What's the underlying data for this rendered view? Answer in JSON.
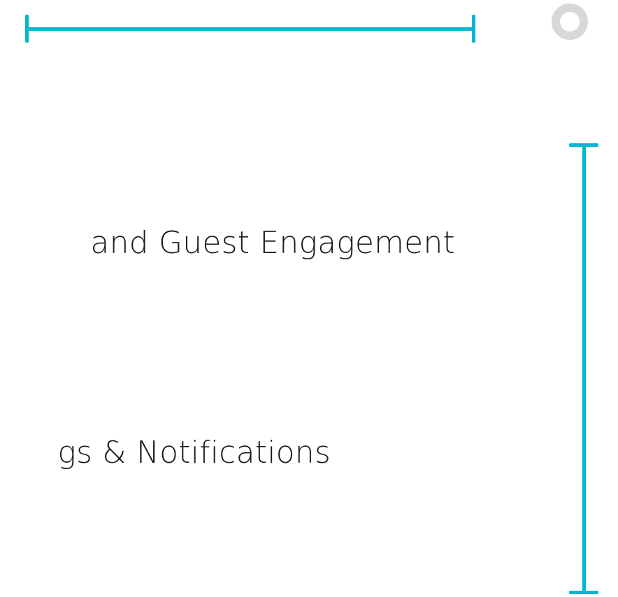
{
  "colors": {
    "accent": "#00b7cf",
    "ring": "#d8d8d8",
    "text": "#1c1c1c"
  },
  "labels": {
    "first": "and Guest  Engagement",
    "second": "gs &  Notifications"
  },
  "icons": {
    "corner_icon": "ring-icon"
  }
}
